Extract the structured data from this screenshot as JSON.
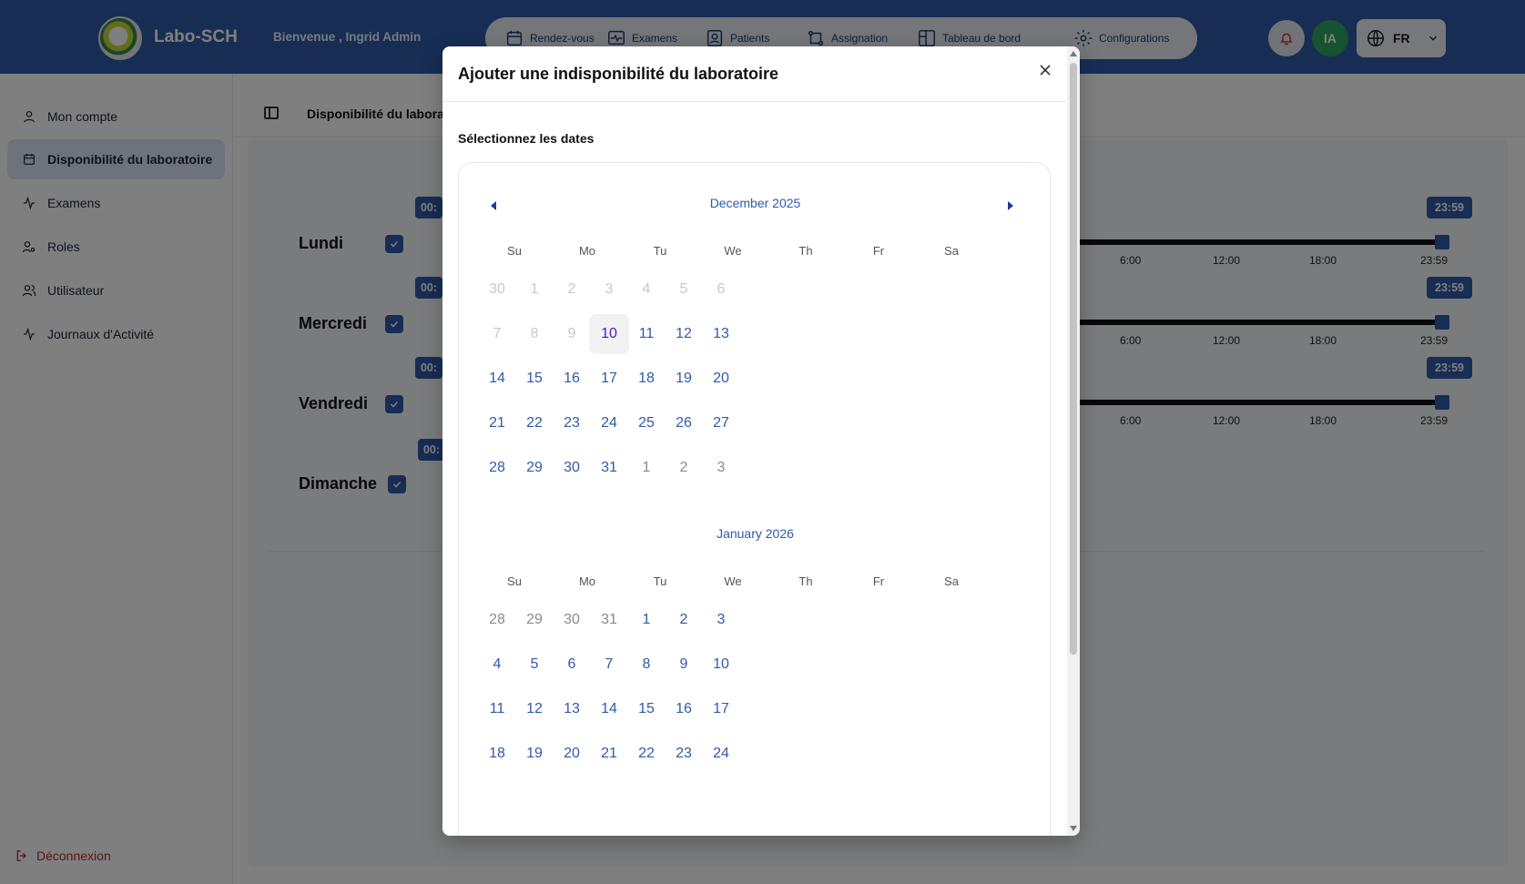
{
  "header": {
    "brand": "Labo-SCH",
    "welcome": "Bienvenue , Ingrid Admin",
    "nav": [
      "Rendez-vous",
      "Examens",
      "Patients",
      "Assignation",
      "Tableau de bord",
      "Configurations"
    ],
    "avatar_initials": "IA",
    "language": "FR"
  },
  "sidebar": {
    "items": [
      "Mon compte",
      "Disponibilité du laboratoire",
      "Examens",
      "Roles",
      "Utilisateur",
      "Journaux d'Activité"
    ],
    "active_index": 1,
    "logout": "Déconnexion"
  },
  "main": {
    "breadcrumb": "Disponibilité du laboratoire",
    "days": [
      "Lundi",
      "Mercredi",
      "Vendredi",
      "Dimanche"
    ],
    "start_tag": "00:",
    "end_tag": "23:59",
    "ticks": [
      "6:00",
      "12:00",
      "18:00",
      "23:59"
    ]
  },
  "modal": {
    "title": "Ajouter une indisponibilité du laboratoire",
    "close": "×",
    "section_label": "Sélectionnez les dates",
    "weekdays": [
      "Su",
      "Mo",
      "Tu",
      "We",
      "Th",
      "Fr",
      "Sa"
    ],
    "months": [
      {
        "title": "December 2025",
        "weeks": [
          [
            "30",
            "1",
            "2",
            "3",
            "4",
            "5",
            "6"
          ],
          [
            "7",
            "8",
            "9",
            "10",
            "11",
            "12",
            "13"
          ],
          [
            "14",
            "15",
            "16",
            "17",
            "18",
            "19",
            "20"
          ],
          [
            "21",
            "22",
            "23",
            "24",
            "25",
            "26",
            "27"
          ],
          [
            "28",
            "29",
            "30",
            "31",
            "1",
            "2",
            "3"
          ]
        ]
      },
      {
        "title": "January 2026",
        "weeks": [
          [
            "28",
            "29",
            "30",
            "31",
            "1",
            "2",
            "3"
          ],
          [
            "4",
            "5",
            "6",
            "7",
            "8",
            "9",
            "10"
          ],
          [
            "11",
            "12",
            "13",
            "14",
            "15",
            "16",
            "17"
          ],
          [
            "18",
            "19",
            "20",
            "21",
            "22",
            "23",
            "24"
          ]
        ]
      }
    ]
  },
  "colors": {
    "primary": "#2f5aa8",
    "avatar": "#2fa463",
    "logout": "#c0292b",
    "today": "#4a18c9"
  }
}
